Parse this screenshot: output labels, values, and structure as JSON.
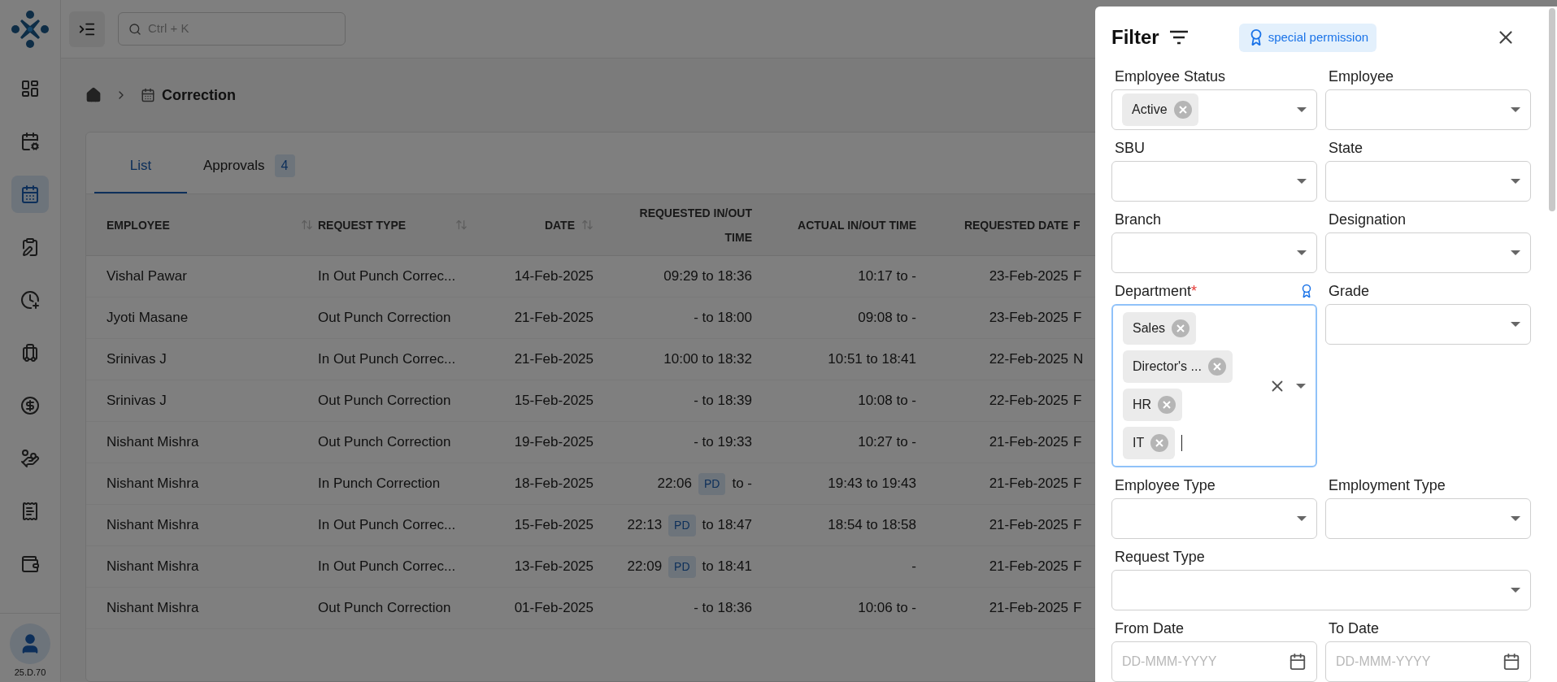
{
  "sidebar": {
    "items": [
      {
        "selected": false
      },
      {
        "selected": false
      },
      {
        "selected": true
      },
      {
        "selected": false
      },
      {
        "selected": false
      },
      {
        "selected": false
      },
      {
        "selected": false
      },
      {
        "selected": false
      },
      {
        "selected": false
      },
      {
        "selected": false
      }
    ],
    "version": "25.D.70"
  },
  "search": {
    "placeholder": "Ctrl + K"
  },
  "breadcrumb": {
    "title": "Correction"
  },
  "tabs": [
    {
      "label": "List",
      "selected": true
    },
    {
      "label": "Approvals",
      "selected": false,
      "badge": "4"
    }
  ],
  "table": {
    "columns": [
      {
        "label": "EMPLOYEE",
        "sortable": true
      },
      {
        "label": "REQUEST TYPE",
        "sortable": true
      },
      {
        "label": "DATE",
        "sortable": true
      },
      {
        "label": "REQUESTED IN/OUT TIME",
        "sortable": false
      },
      {
        "label": "ACTUAL IN/OUT TIME",
        "sortable": false
      },
      {
        "label": "REQUESTED DATE",
        "sortable": false
      },
      {
        "label": "F",
        "sortable": false
      }
    ],
    "rows": [
      {
        "cells": [
          {
            "text": "Vishal Pawar"
          },
          {
            "text": "In Out Punch Correc..."
          },
          {
            "text": "14-Feb-2025"
          },
          {
            "text": "09:29 to 18:36"
          },
          {
            "text": "10:17 to -"
          },
          {
            "text": "23-Feb-2025"
          },
          {
            "text": "F"
          }
        ]
      },
      {
        "cells": [
          {
            "text": "Jyoti Masane"
          },
          {
            "text": "Out Punch Correction"
          },
          {
            "text": "21-Feb-2025"
          },
          {
            "text": "- to 18:00"
          },
          {
            "text": "09:08 to -"
          },
          {
            "text": "23-Feb-2025"
          },
          {
            "text": "F"
          }
        ]
      },
      {
        "cells": [
          {
            "text": "Srinivas J"
          },
          {
            "text": "In Out Punch Correc..."
          },
          {
            "text": "21-Feb-2025"
          },
          {
            "text": "10:00 to 18:32"
          },
          {
            "text": "10:51 to 18:41"
          },
          {
            "text": "22-Feb-2025"
          },
          {
            "text": "N"
          }
        ]
      },
      {
        "cells": [
          {
            "text": "Srinivas J"
          },
          {
            "text": "Out Punch Correction"
          },
          {
            "text": "15-Feb-2025"
          },
          {
            "text": "- to 18:39"
          },
          {
            "text": "10:08 to -"
          },
          {
            "text": "22-Feb-2025"
          },
          {
            "text": "F"
          }
        ]
      },
      {
        "cells": [
          {
            "text": "Nishant Mishra"
          },
          {
            "text": "Out Punch Correction"
          },
          {
            "text": "19-Feb-2025"
          },
          {
            "text": "- to 19:33"
          },
          {
            "text": "10:27 to -"
          },
          {
            "text": "21-Feb-2025"
          },
          {
            "text": "F"
          }
        ]
      },
      {
        "cells": [
          {
            "text": "Nishant Mishra"
          },
          {
            "text": "In Punch Correction"
          },
          {
            "text": "18-Feb-2025"
          },
          {
            "text": "22:06",
            "badge": "PD",
            "end": "to -"
          },
          {
            "text": "19:43 to 19:43"
          },
          {
            "text": "21-Feb-2025"
          },
          {
            "text": "F"
          }
        ]
      },
      {
        "cells": [
          {
            "text": "Nishant Mishra"
          },
          {
            "text": "In Out Punch Correc..."
          },
          {
            "text": "15-Feb-2025"
          },
          {
            "text": "22:13",
            "badge": "PD",
            "end": "to 18:47"
          },
          {
            "text": "18:54 to 18:58"
          },
          {
            "text": "21-Feb-2025"
          },
          {
            "text": "F"
          }
        ]
      },
      {
        "cells": [
          {
            "text": "Nishant Mishra"
          },
          {
            "text": "In Out Punch Correc..."
          },
          {
            "text": "13-Feb-2025"
          },
          {
            "text": "22:09",
            "badge": "PD",
            "end": "to 18:41"
          },
          {
            "text": "-"
          },
          {
            "text": "21-Feb-2025"
          },
          {
            "text": "F"
          }
        ]
      },
      {
        "cells": [
          {
            "text": "Nishant Mishra"
          },
          {
            "text": "Out Punch Correction"
          },
          {
            "text": "01-Feb-2025"
          },
          {
            "text": "- to 18:36"
          },
          {
            "text": "10:06 to -"
          },
          {
            "text": "21-Feb-2025"
          },
          {
            "text": "F"
          }
        ]
      }
    ]
  },
  "filter": {
    "title": "Filter",
    "permission_badge": "special permission",
    "fields": [
      {
        "label": "Employee Status",
        "kind": "select",
        "chips": [
          "Active"
        ],
        "special": false,
        "focused": false,
        "wide": false
      },
      {
        "label": "Employee",
        "kind": "select",
        "special": false,
        "focused": false,
        "wide": false
      },
      {
        "label": "SBU",
        "kind": "select",
        "special": false,
        "focused": false,
        "wide": false
      },
      {
        "label": "State",
        "kind": "select",
        "special": false,
        "focused": false,
        "wide": false
      },
      {
        "label": "Branch",
        "kind": "select",
        "special": false,
        "focused": false,
        "wide": false
      },
      {
        "label": "Designation",
        "kind": "select",
        "special": false,
        "focused": false,
        "wide": false
      },
      {
        "label": "Department",
        "kind": "select",
        "chips": [
          "Sales",
          "Director's ...",
          "HR",
          "IT"
        ],
        "required_mark": "*",
        "special": true,
        "focused": true,
        "wide": false
      },
      {
        "label": "Grade",
        "kind": "select",
        "special": false,
        "focused": false,
        "wide": false
      },
      {
        "label": "Employee Type",
        "kind": "select",
        "special": false,
        "focused": false,
        "wide": false
      },
      {
        "label": "Employment Type",
        "kind": "select",
        "special": false,
        "focused": false,
        "wide": false
      },
      {
        "label": "Request Type",
        "kind": "select",
        "special": false,
        "focused": false,
        "wide": true
      },
      {
        "label": "From Date",
        "kind": "date",
        "placeholder": "DD-MMM-YYYY",
        "special": false,
        "focused": false,
        "wide": false
      },
      {
        "label": "To Date",
        "kind": "date",
        "placeholder": "DD-MMM-YYYY",
        "special": false,
        "focused": false,
        "wide": false
      }
    ]
  }
}
